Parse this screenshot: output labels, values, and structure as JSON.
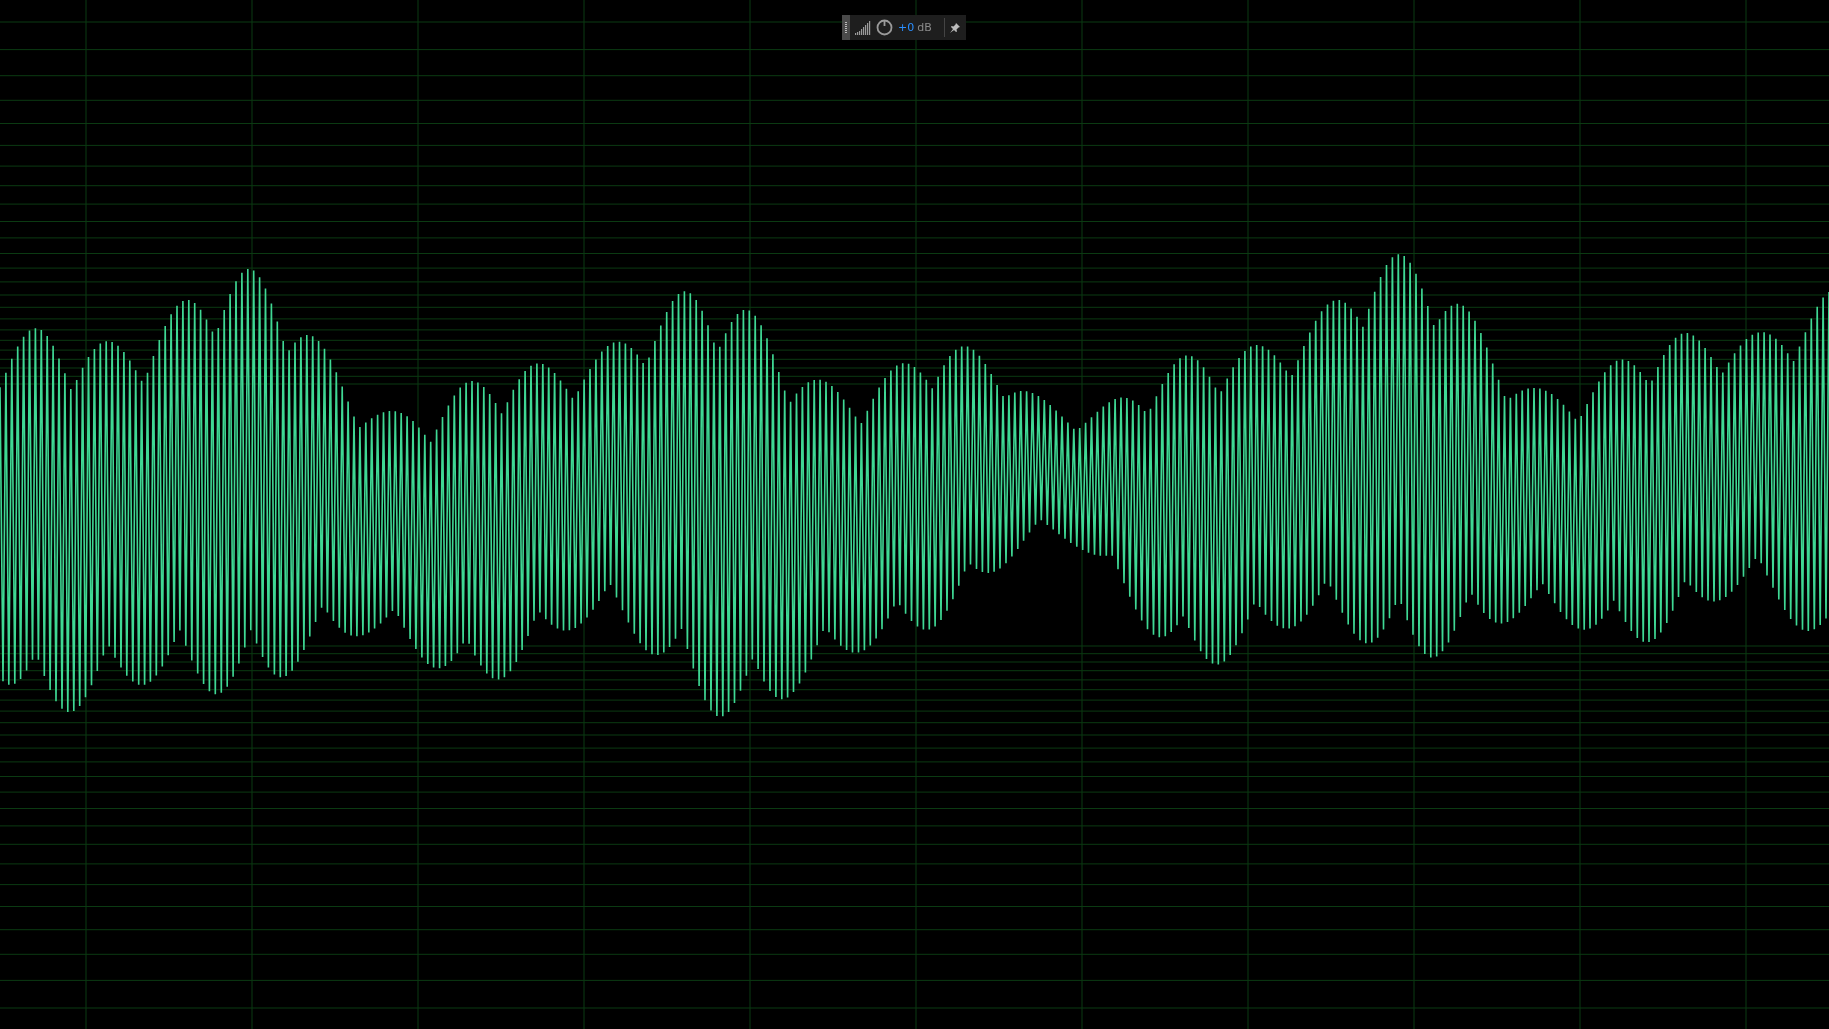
{
  "level_display": {
    "gain": "+0",
    "unit": "dB"
  }
}
